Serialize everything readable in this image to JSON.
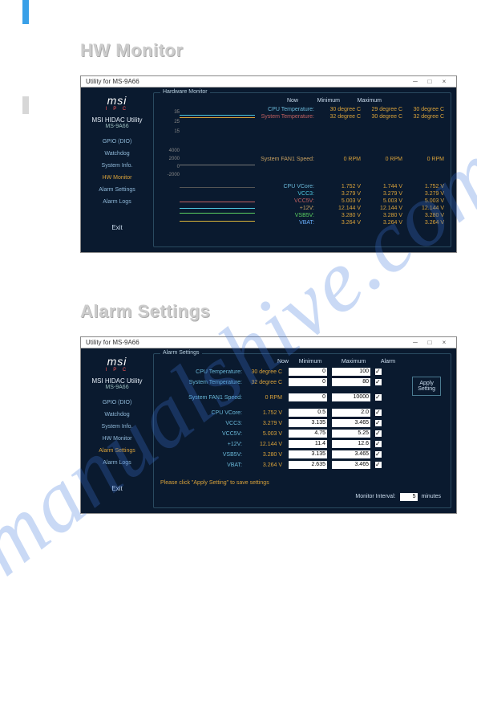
{
  "section1_title": "HW Monitor",
  "section2_title": "Alarm Settings",
  "window_title": "Utility for MS-9A66",
  "logo": "msi",
  "logo_sub": "I P C",
  "app_name": "MSI HIDAC Utility",
  "app_model": "MS-9A66",
  "nav": [
    "GPIO (DIO)",
    "Watchdog",
    "System Info.",
    "HW Monitor",
    "Alarm Settings",
    "Alarm Logs"
  ],
  "exit": "Exit",
  "hw_panel_label": "Hardware Monitor",
  "alarm_panel_label": "Alarm Settings",
  "cols": {
    "now": "Now",
    "min": "Minimum",
    "max": "Maximum",
    "alarm": "Alarm"
  },
  "hw_temp": [
    {
      "label": "CPU Temperature:",
      "now": "30 degree C",
      "min": "29 degree C",
      "max": "30 degree C",
      "cls": "c-lab-cyan",
      "vcls": "c-yellow"
    },
    {
      "label": "System Temperature:",
      "now": "32 degree C",
      "min": "30 degree C",
      "max": "32 degree C",
      "cls": "c-lab-red",
      "vcls": "c-yellow"
    }
  ],
  "hw_fan": {
    "label": "System FAN1 Speed:",
    "now": "0 RPM",
    "min": "0 RPM",
    "max": "0 RPM",
    "cls": "c-lab-gold",
    "vcls": "c-yellow"
  },
  "hw_volt": [
    {
      "label": "CPU VCore:",
      "now": "1.752 V",
      "min": "1.744 V",
      "max": "1.752 V",
      "cls": "c-lab-cyan",
      "vcls": "c-yellow"
    },
    {
      "label": "VCC3:",
      "now": "3.279 V",
      "min": "3.279 V",
      "max": "3.279 V",
      "cls": "c-cyan",
      "vcls": "c-yellow"
    },
    {
      "label": "VCC5V:",
      "now": "5.003 V",
      "min": "5.003 V",
      "max": "5.003 V",
      "cls": "c-lab-red",
      "vcls": "c-yellow"
    },
    {
      "label": "+12V:",
      "now": "12.144 V",
      "min": "12.144 V",
      "max": "12.144 V",
      "cls": "c-lab-gold",
      "vcls": "c-yellow"
    },
    {
      "label": "VSB5V:",
      "now": "3.280 V",
      "min": "3.280 V",
      "max": "3.280 V",
      "cls": "c-green",
      "vcls": "c-yellow"
    },
    {
      "label": "VBAT:",
      "now": "3.264 V",
      "min": "3.264 V",
      "max": "3.264 V",
      "cls": "c-blue",
      "vcls": "c-yellow"
    }
  ],
  "axis1": [
    "35",
    "25",
    "15"
  ],
  "axis2": [
    "4000",
    "2000",
    "0",
    "-2000"
  ],
  "alarm_rows": [
    {
      "label": "CPU Temperature:",
      "now": "30 degree C",
      "min": "0",
      "max": "100",
      "checked": true
    },
    {
      "label": "System Temperature:",
      "now": "32 degree C",
      "min": "0",
      "max": "80",
      "checked": true
    }
  ],
  "alarm_fan": {
    "label": "System FAN1 Speed:",
    "now": "0 RPM",
    "min": "0",
    "max": "10000",
    "checked": true
  },
  "alarm_volt": [
    {
      "label": "CPU VCore:",
      "now": "1.752 V",
      "min": "0.5",
      "max": "2.0",
      "checked": true
    },
    {
      "label": "VCC3:",
      "now": "3.279 V",
      "min": "3.135",
      "max": "3.465",
      "checked": true
    },
    {
      "label": "VCC5V:",
      "now": "5.003 V",
      "min": "4.75",
      "max": "5.25",
      "checked": true
    },
    {
      "label": "+12V:",
      "now": "12.144 V",
      "min": "11.4",
      "max": "12.6",
      "checked": true
    },
    {
      "label": "VSB5V:",
      "now": "3.280 V",
      "min": "3.135",
      "max": "3.465",
      "checked": true
    },
    {
      "label": "VBAT:",
      "now": "3.264 V",
      "min": "2.635",
      "max": "3.465",
      "checked": true
    }
  ],
  "apply_button": "Apply\nSetting",
  "footer_msg": "Please click \"Apply Setting\" to save settings",
  "monitor_interval_label": "Monitor Interval:",
  "monitor_interval_value": "5",
  "monitor_interval_unit": "minutes",
  "watermark": "manualshive.com"
}
